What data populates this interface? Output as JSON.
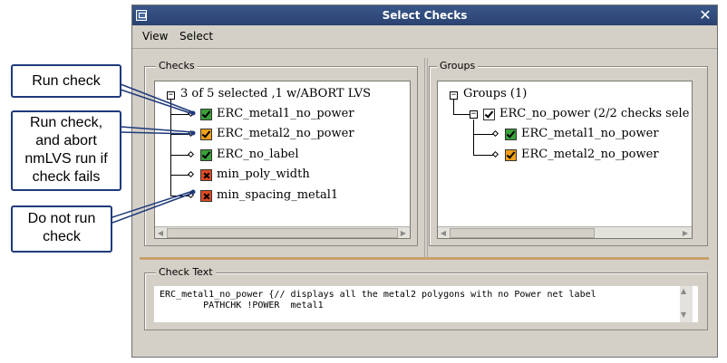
{
  "window": {
    "title": "Select Checks"
  },
  "menu": {
    "items": [
      "View",
      "Select"
    ]
  },
  "checks_panel": {
    "caption": "Checks",
    "root": "3 of 5 selected ,1 w/ABORT LVS",
    "items": [
      {
        "label": "ERC_metal1_no_power",
        "state": "run"
      },
      {
        "label": "ERC_metal2_no_power",
        "state": "abort"
      },
      {
        "label": "ERC_no_label",
        "state": "run"
      },
      {
        "label": "min_poly_width",
        "state": "off"
      },
      {
        "label": "min_spacing_metal1",
        "state": "off"
      }
    ]
  },
  "groups_panel": {
    "caption": "Groups",
    "root": "Groups (1)",
    "group": "ERC_no_power (2/2 checks sele",
    "items": [
      {
        "label": "ERC_metal1_no_power",
        "state": "run"
      },
      {
        "label": "ERC_metal2_no_power",
        "state": "abort"
      }
    ]
  },
  "check_text": {
    "caption": "Check Text",
    "line1": "ERC_metal1_no_power {// displays all the metal2 polygons with no Power net label",
    "line2": "        PATHCHK !POWER  metal1"
  },
  "callouts": {
    "run": "Run check",
    "abort_line1": "Run check,",
    "abort_line2": "and abort",
    "abort_line3": "nmLVS run if",
    "abort_line4": "check fails",
    "off_line1": "Do not run",
    "off_line2": "check"
  },
  "colors": {
    "run": "#3aa03a",
    "abort": "#f2a01b",
    "off": "#e04a24",
    "title_bar": "#2a4270"
  }
}
